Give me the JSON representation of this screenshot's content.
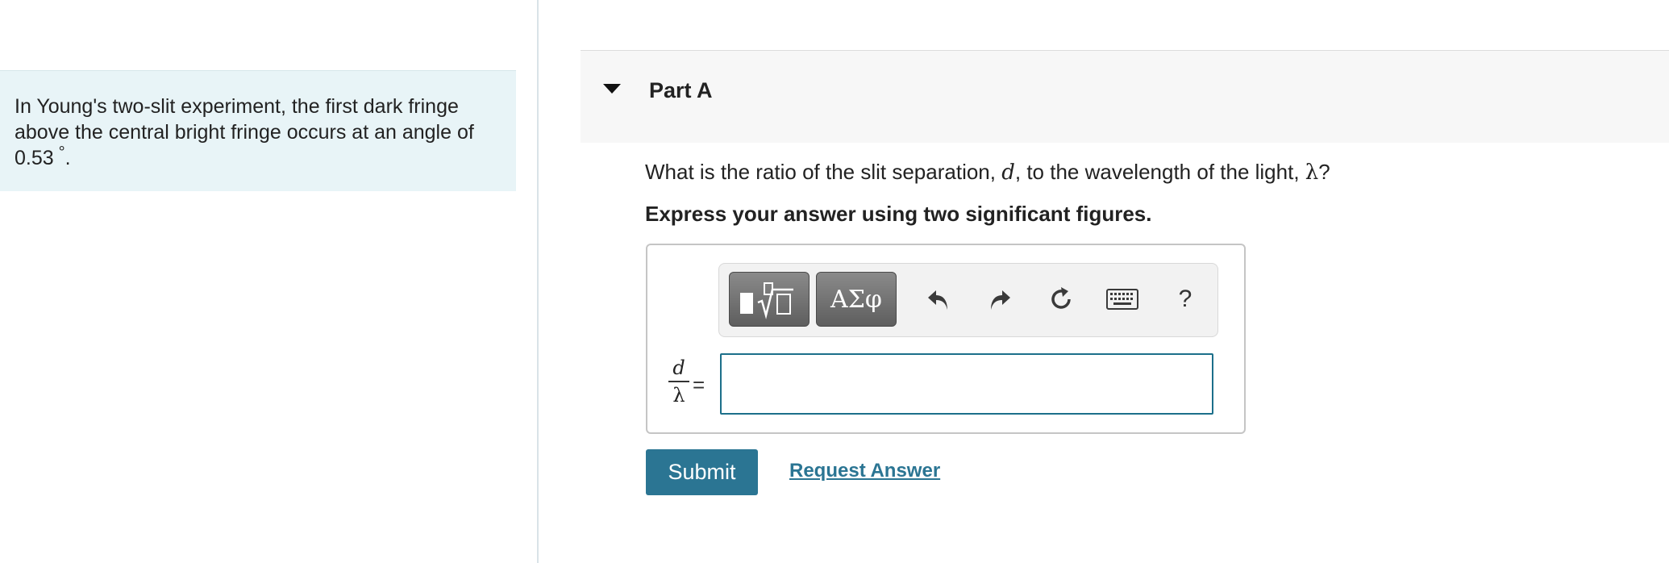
{
  "intro": {
    "text": "In Young's two-slit experiment, the first dark fringe above the central bright fringe occurs at an angle of 0.53",
    "degree_symbol": "°",
    "period": "."
  },
  "part": {
    "title": "Part A",
    "question_start": "What is the ratio of the slit separation, ",
    "question_var_d": "d",
    "question_middle": ", to the wavelength of the light, ",
    "question_var_lambda": "λ",
    "question_end": "?",
    "instruction": "Express your answer using two significant figures."
  },
  "toolbar": {
    "templates_icon": "math-templates-icon",
    "symbols_label": "ΑΣφ",
    "undo_icon": "undo-icon",
    "redo_icon": "redo-icon",
    "reset_icon": "reset-icon",
    "keyboard_icon": "keyboard-icon",
    "help_label": "?"
  },
  "answer": {
    "numerator": "d",
    "denominator": "λ",
    "equals": "=",
    "value": ""
  },
  "actions": {
    "submit_label": "Submit",
    "request_answer_label": "Request Answer"
  },
  "colors": {
    "accent": "#2b7593",
    "intro_bg": "#e8f4f7",
    "part_header_bg": "#f7f7f7",
    "input_border": "#1c6f8a"
  }
}
